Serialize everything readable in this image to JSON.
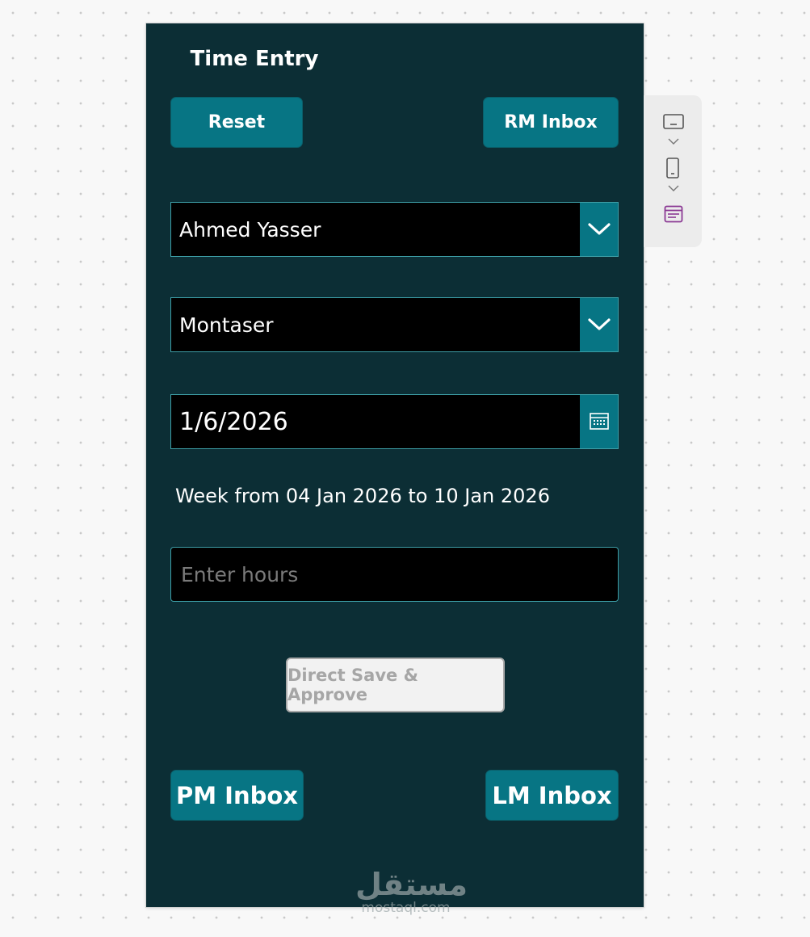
{
  "screen": {
    "title": "Time Entry",
    "reset_label": "Reset",
    "rm_inbox_label": "RM Inbox",
    "employee_dropdown": {
      "value": "Ahmed Yasser",
      "icon": "chevron-down-icon"
    },
    "project_dropdown": {
      "value": "Montaser",
      "icon": "chevron-down-icon"
    },
    "date_picker": {
      "value": "1/6/2026",
      "icon": "calendar-icon"
    },
    "week_text": "Week from 04 Jan 2026 to 10 Jan 2026",
    "hours_input": {
      "value": "",
      "placeholder": "Enter hours"
    },
    "direct_save_label": "Direct Save & Approve",
    "pm_inbox_label": "PM Inbox",
    "lm_inbox_label": "LM Inbox"
  },
  "side_rail": {
    "items": [
      "tablet-layout-icon",
      "phone-layout-icon",
      "form-layout-icon"
    ]
  },
  "watermark": {
    "arabic": "مستقل",
    "latin": "mostaql.com"
  },
  "colors": {
    "background": "#0c2e35",
    "accent": "#077584",
    "field_border": "#3d9ea6",
    "disabled_button": "#f2f2f2"
  }
}
